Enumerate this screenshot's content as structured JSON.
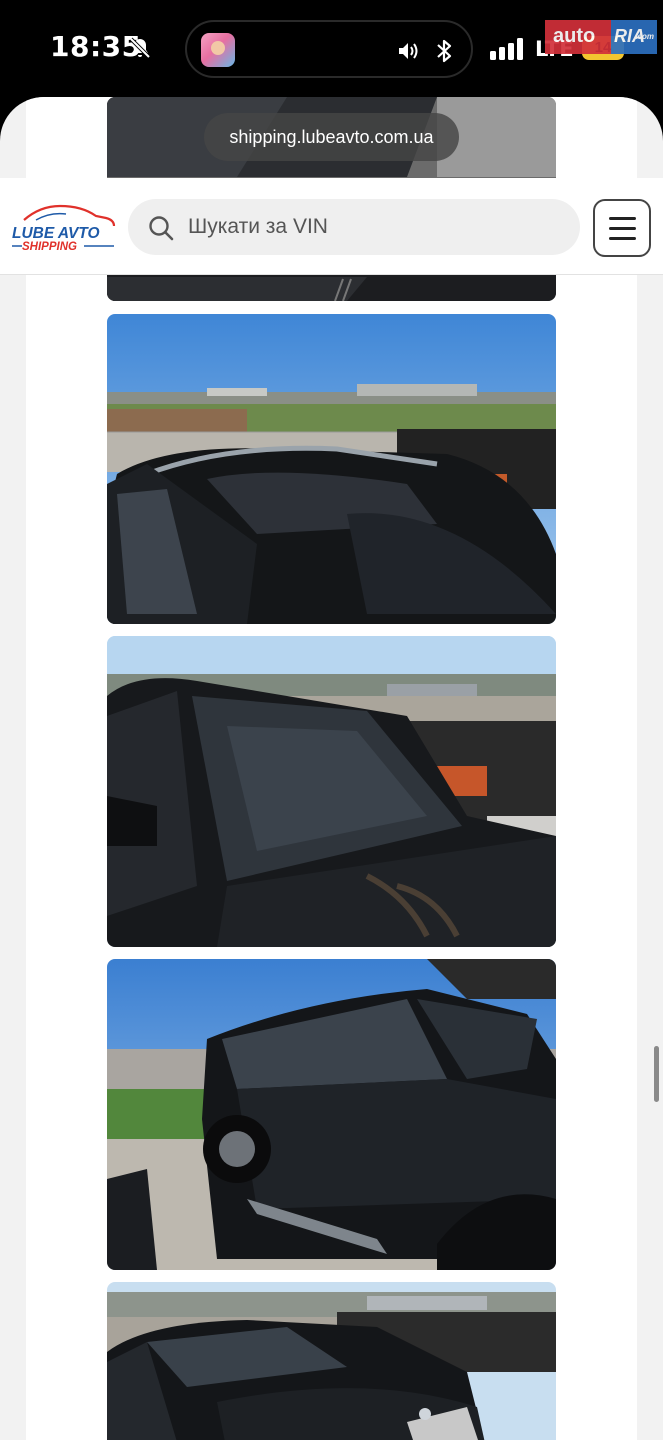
{
  "status_bar": {
    "time": "18:35",
    "network": "LTE",
    "battery": "14",
    "icons": [
      "bell-slash-icon",
      "audio-wave-icon",
      "bluetooth-icon",
      "signal-icon",
      "battery-icon"
    ]
  },
  "watermark": {
    "part1": "auto",
    "part2": "RIA",
    "suffix": ".com"
  },
  "browser": {
    "url": "shipping.lubeavto.com.ua"
  },
  "header": {
    "logo_line1": "LUBE AVTO",
    "logo_line2": "SHIPPING",
    "search_placeholder": "Шукати за VIN"
  },
  "colors": {
    "logo_red": "#e0312b",
    "logo_blue": "#1e5aa8",
    "sheet_bg": "#f2f2f2"
  }
}
